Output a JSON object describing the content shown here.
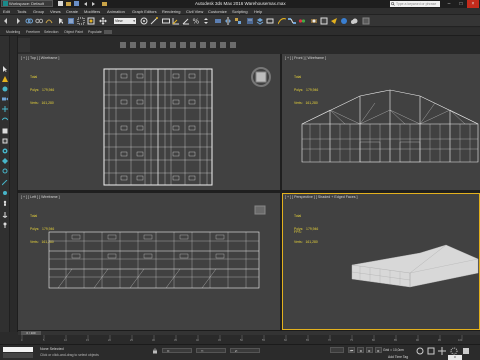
{
  "window": {
    "workspace_label": "Workspace: Default",
    "title": "Autodesk 3ds Max 2016    Warehousemax.max",
    "search_placeholder": "Type a keyword or phrase"
  },
  "menu": [
    "Edit",
    "Tools",
    "Group",
    "Views",
    "Create",
    "Modifiers",
    "Animation",
    "Graph Editors",
    "Rendering",
    "Civil View",
    "Customize",
    "Scripting",
    "Help"
  ],
  "toolbar": {
    "selection_filter": "View"
  },
  "ribbon": {
    "tabs": [
      "Modeling",
      "Freeform",
      "Selection",
      "Object Paint",
      "Populate"
    ]
  },
  "viewports": {
    "top": {
      "label": "[ + ] [ Top ] [ Wireframe ]",
      "stats_title": "Total",
      "polys": "Polys:   179,946",
      "verts": "Verts:   161,280"
    },
    "front": {
      "label": "[ + ] [ Front ] [ Wireframe ]",
      "stats_title": "Total",
      "polys": "Polys:   179,946",
      "verts": "Verts:   161,280"
    },
    "left": {
      "label": "[ + ] [ Left ] [ Wireframe ]",
      "stats_title": "Total",
      "polys": "Polys:   179,946",
      "verts": "Verts:   161,280"
    },
    "perspective": {
      "label": "[ + ] [ Perspective ] [ Shaded + Edged Faces ]",
      "stats_title": "Total",
      "polys": "Polys:   179,946",
      "verts": "Verts:   161,280",
      "fps": "FPS:"
    }
  },
  "timeline": {
    "slider_label": "0 / 100",
    "ticks": [
      "0",
      "5",
      "10",
      "15",
      "20",
      "25",
      "30",
      "35",
      "40",
      "45",
      "50",
      "55",
      "60",
      "65",
      "70",
      "75",
      "80",
      "85",
      "90",
      "95",
      "100"
    ]
  },
  "status": {
    "selection": "None Selected",
    "hint": "Click or click-and-drag to select objects",
    "x": "X:",
    "y": "Y:",
    "z": "Z:",
    "grid": "Grid = 10,0cm",
    "add_time_tag": "Add Time Tag",
    "frame": "0"
  },
  "colors": {
    "accent": "#e3b11e",
    "stats": "#e6d23a",
    "viewport_bg": "#414141",
    "wire": "#f2f2f2"
  }
}
